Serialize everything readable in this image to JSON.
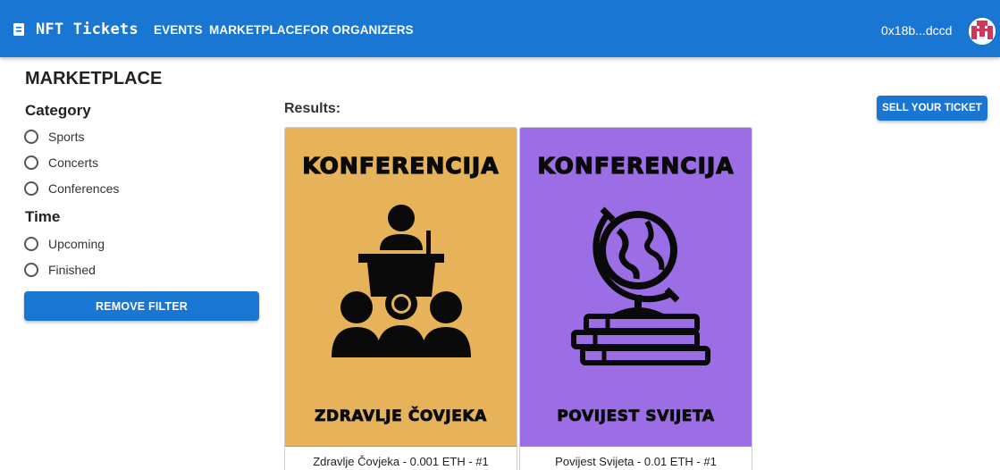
{
  "header": {
    "brand": "NFT Tickets",
    "nav": [
      "EVENTS",
      "MARKETPLACE",
      "FOR ORGANIZERS"
    ],
    "wallet": "0x18b...dccd",
    "bar_color": "#1976d2"
  },
  "page": {
    "title": "MARKETPLACE"
  },
  "filters": {
    "category_title": "Category",
    "categories": [
      "Sports",
      "Concerts",
      "Conferences"
    ],
    "time_title": "Time",
    "times": [
      "Upcoming",
      "Finished"
    ],
    "remove_label": "REMOVE FILTER"
  },
  "results": {
    "title": "Results:",
    "sell_label": "SELL YOUR TICKET",
    "tickets": [
      {
        "top_text": "KONFERENCIJA",
        "bottom_text": "ZDRAVLJE ČOVJEKA",
        "caption": "Zdravlje Čovjeka - 0.001 ETH - #1",
        "bg_color": "#e6b25a",
        "icon": "lecture-audience-icon"
      },
      {
        "top_text": "KONFERENCIJA",
        "bottom_text": "POVIJEST SVIJETA",
        "caption": "Povijest Svijeta - 0.01 ETH - #1",
        "bg_color": "#9c6ee6",
        "icon": "globe-books-icon"
      }
    ]
  }
}
